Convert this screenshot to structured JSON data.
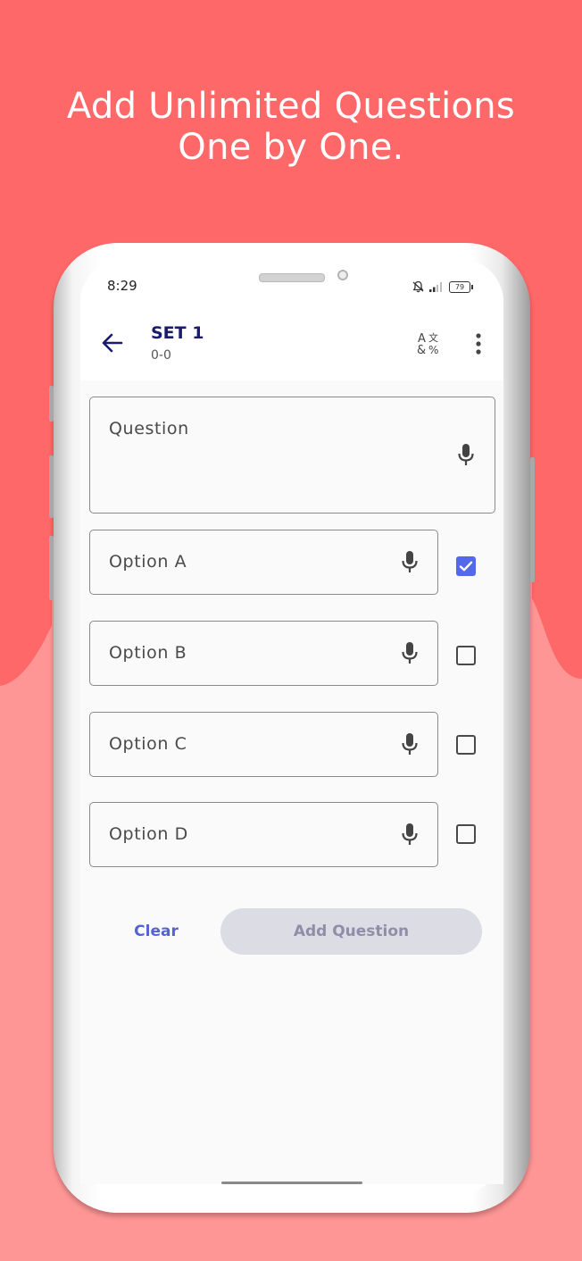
{
  "banner": {
    "headline_line1": "Add Unlimited Questions",
    "headline_line2": "One by One.",
    "colors": {
      "top": "#ff6868",
      "bottom": "#ff9696"
    }
  },
  "status_bar": {
    "time": "8:29",
    "icons": [
      "bell-muted-icon",
      "signal-icon",
      "battery-icon"
    ],
    "battery_level": "79"
  },
  "app_bar": {
    "back_icon": "arrow-left-icon",
    "title": "SET 1",
    "subtitle": "0-0",
    "actions": [
      "translate-icon",
      "more-vert-icon"
    ]
  },
  "form": {
    "question": {
      "placeholder": "Question",
      "value": "",
      "icon": "mic-icon"
    },
    "options": [
      {
        "placeholder": "Option A",
        "value": "",
        "icon": "mic-icon",
        "correct": true
      },
      {
        "placeholder": "Option B",
        "value": "",
        "icon": "mic-icon",
        "correct": false
      },
      {
        "placeholder": "Option C",
        "value": "",
        "icon": "mic-icon",
        "correct": false
      },
      {
        "placeholder": "Option D",
        "value": "",
        "icon": "mic-icon",
        "correct": false
      }
    ],
    "clear_label": "Clear",
    "add_label": "Add Question",
    "add_enabled": false,
    "accent": "#5468ec"
  }
}
